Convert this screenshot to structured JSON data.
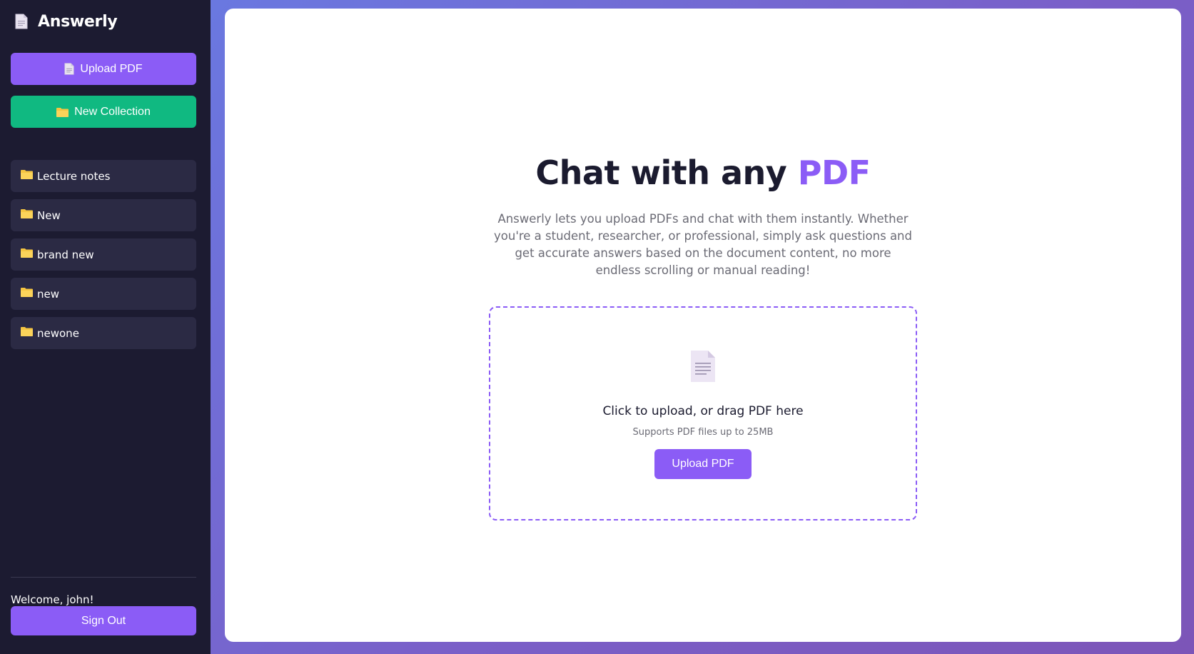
{
  "app": {
    "name": "Answerly",
    "logo_icon": "document-icon"
  },
  "sidebar": {
    "upload_button": {
      "label": "Upload PDF",
      "icon": "document-icon"
    },
    "new_collection_button": {
      "label": "New Collection",
      "icon": "folder-icon"
    },
    "collections": [
      {
        "label": "Lecture notes",
        "icon": "folder-icon"
      },
      {
        "label": "New",
        "icon": "folder-icon"
      },
      {
        "label": "brand new",
        "icon": "folder-icon"
      },
      {
        "label": "new",
        "icon": "folder-icon"
      },
      {
        "label": "newone",
        "icon": "folder-icon"
      }
    ],
    "welcome_text": "Welcome, john!",
    "sign_out_label": "Sign Out"
  },
  "main": {
    "title_prefix": "Chat with any",
    "title_accent": "PDF",
    "description": "Answerly lets you upload PDFs and chat with them instantly. Whether you're a student, researcher, or professional, simply ask questions and get accurate answers based on the document content, no more endless scrolling or manual reading!",
    "dropzone": {
      "icon": "document-icon",
      "title": "Click to upload, or drag PDF here",
      "subtitle": "Supports PDF files up to 25MB",
      "button_label": "Upload PDF"
    }
  },
  "colors": {
    "sidebar_bg": "#1c1b31",
    "collection_bg": "#2b2a44",
    "accent_purple": "#8b5cf6",
    "accent_green": "#10b981",
    "folder_yellow": "#f5c542"
  }
}
